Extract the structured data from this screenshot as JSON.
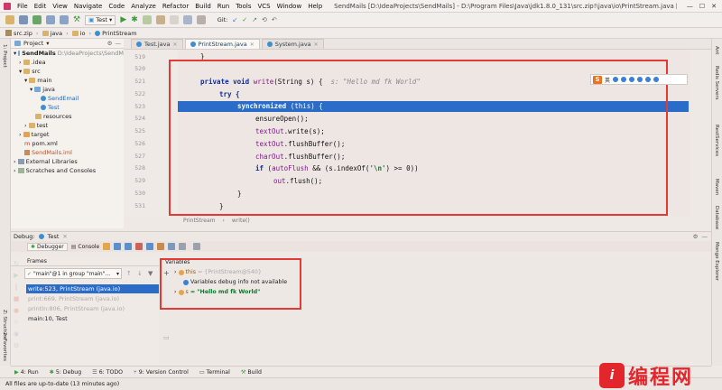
{
  "menubar": {
    "items": [
      "File",
      "Edit",
      "View",
      "Navigate",
      "Code",
      "Analyze",
      "Refactor",
      "Build",
      "Run",
      "Tools",
      "VCS",
      "Window",
      "Help"
    ],
    "title": "SendMails [D:\\IdeaProjects\\SendMails] - D:\\Program Files\\Java\\jdk1.8.0_131\\src.zip!\\java\\io\\PrintStream.java [1.8] - IntelliJ IDEA"
  },
  "toolbar": {
    "run_config": "Test",
    "git_label": "Git:"
  },
  "navbar": {
    "crumbs": [
      "src.zip",
      "java",
      "io",
      "PrintStream"
    ]
  },
  "left_strip": {
    "project": "1: Project",
    "structure": "Z: Structure",
    "favorites": "2: Favorites"
  },
  "right_strip": {
    "ant": "Ant",
    "redis": "Redis Servers",
    "restservices": "RestServices",
    "maven": "Maven",
    "database": "Database",
    "mongo": "Mongo Explorer"
  },
  "project": {
    "header": "Project",
    "tree": [
      {
        "label": "SendMails",
        "extra": "D:\\IdeaProjects\\SendM"
      },
      {
        "label": ".idea"
      },
      {
        "label": "src"
      },
      {
        "label": "main"
      },
      {
        "label": "java"
      },
      {
        "label": "SendEmail"
      },
      {
        "label": "Test"
      },
      {
        "label": "resources"
      },
      {
        "label": "test"
      },
      {
        "label": "target"
      },
      {
        "label": "pom.xml"
      },
      {
        "label": "SendMails.iml"
      },
      {
        "label": "External Libraries"
      },
      {
        "label": "Scratches and Consoles"
      }
    ]
  },
  "editor": {
    "tabs": [
      "Test.java",
      "PrintStream.java",
      "System.java"
    ],
    "line_numbers": [
      "519",
      "520",
      "521",
      "522",
      "523",
      "524",
      "525",
      "526",
      "527",
      "528",
      "529",
      "530",
      "531"
    ],
    "lines": {
      "l519": "}",
      "l521_kw1": "private void",
      "l521_fn": "write",
      "l521_rest": "(String s) {",
      "l521_hint": "s: \"Hello md fk World\"",
      "l522": "try {",
      "l523_kw": "synchronized",
      "l523_rest": "(this) {",
      "l524": "ensureOpen();",
      "l525_a": "textOut",
      "l525_b": ".write(s);",
      "l526_a": "textOut",
      "l526_b": ".flushBuffer();",
      "l527_a": "charOut",
      "l527_b": ".flushBuffer();",
      "l528_kw": "if",
      "l528_a": "(",
      "l528_b": "autoFlush",
      "l528_c": " && (s.indexOf(",
      "l528_d": "'\\n'",
      "l528_e": ") >= 0))",
      "l529_a": "out",
      "l529_b": ".flush();",
      "l530": "}",
      "l531": "}"
    },
    "breadcrumb": [
      "PrintStream",
      "write()"
    ]
  },
  "debug": {
    "title": "Debug:",
    "config": "Test",
    "tabs": [
      "Debugger",
      "Console"
    ],
    "frames_label": "Frames",
    "thread": "\"main\"@1 in group \"main\"...",
    "frames": [
      "write:523, PrintStream (java.io)",
      "print:669, PrintStream (java.io)",
      "println:806, PrintStream (java.io)",
      "main:10, Test"
    ],
    "variables_label": "Variables",
    "vars": {
      "this_name": "this",
      "this_val": "= {PrintStream@540}",
      "info": "Variables debug info not available",
      "s_name": "s",
      "s_val": "= \"Hello md fk World\""
    }
  },
  "bottom_tabs": [
    "4: Run",
    "5: Debug",
    "6: TODO",
    "9: Version Control",
    "Terminal",
    "Build"
  ],
  "status": "All files are up-to-date (13 minutes ago)",
  "watermark": "编程网"
}
